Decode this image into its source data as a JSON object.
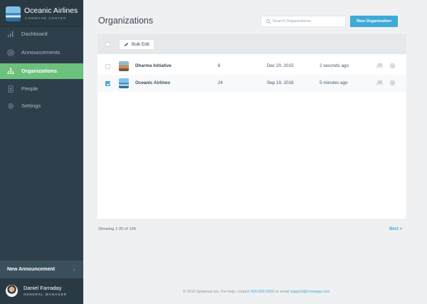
{
  "brand": {
    "title": "Oceanic Airlines",
    "subtitle": "COMMAND CENTER"
  },
  "nav": {
    "items": [
      {
        "label": "Dashboard",
        "icon": "bar-chart-icon",
        "active": false
      },
      {
        "label": "Announcements",
        "icon": "broadcast-icon",
        "active": false
      },
      {
        "label": "Organizations",
        "icon": "org-chart-icon",
        "active": true
      },
      {
        "label": "People",
        "icon": "id-card-icon",
        "active": false
      },
      {
        "label": "Settings",
        "icon": "gear-icon",
        "active": false
      }
    ]
  },
  "new_announcement": {
    "label": "New Announcement",
    "chevron": "›"
  },
  "user": {
    "name": "Daniel Farraday",
    "role": "GENERAL MANAGER"
  },
  "header": {
    "title": "Organizations",
    "search_placeholder": "Search Organizations",
    "search_value": "",
    "new_button": "New Organization"
  },
  "toolbar": {
    "bulk_edit_label": "Bulk Edit"
  },
  "table": {
    "rows": [
      {
        "name": "Dharma Initiative",
        "count": "8",
        "date": "Dec 20, 2015",
        "updated": "2 seconds ago",
        "checked": false
      },
      {
        "name": "Oceanic Airlines",
        "count": "24",
        "date": "Sep 19, 2016",
        "updated": "5 minutes ago",
        "checked": true
      }
    ]
  },
  "pagination": {
    "showing": "Showing 1-20 of 145",
    "next": "Next >"
  },
  "footer": {
    "prefix": "© 2016 Spiramus Inc. For help, contact ",
    "phone": "416-555-5555",
    "middle": " or email ",
    "email": "support@crowapp.com"
  },
  "colors": {
    "sidebar": "#2e3f4b",
    "active_nav": "#6cc17c",
    "accent": "#3fa9d8",
    "background": "#eef0f2"
  }
}
